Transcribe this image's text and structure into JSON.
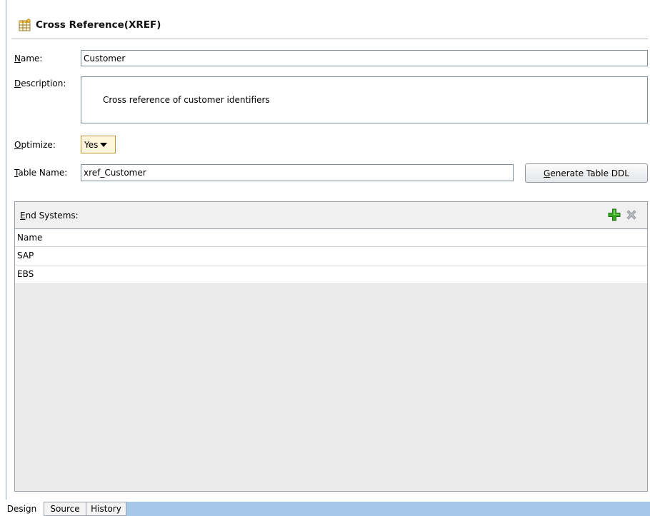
{
  "header": {
    "title": "Cross Reference(XREF)",
    "icon": "xref-table-icon"
  },
  "form": {
    "name_label": {
      "mnemonic": "N",
      "rest": "ame:"
    },
    "name_value": "Customer",
    "description_label": {
      "mnemonic": "D",
      "rest": "escription:"
    },
    "description_value": "Cross reference of customer identifiers",
    "optimize_label": {
      "mnemonic": "O",
      "rest": "ptimize:"
    },
    "optimize_value": "Yes",
    "table_name_label": {
      "mnemonic": "T",
      "rest": "able Name:"
    },
    "table_name_value": "xref_Customer",
    "generate_button": {
      "mnemonic": "G",
      "rest": "enerate Table DDL"
    }
  },
  "end_systems": {
    "label": {
      "mnemonic": "E",
      "rest": "nd Systems:"
    },
    "add_icon": "add-icon",
    "remove_icon": "remove-icon",
    "column_header": "Name",
    "rows": [
      "SAP",
      "EBS"
    ]
  },
  "tabs": [
    "Design",
    "Source",
    "History"
  ],
  "colors": {
    "accent_select": "#c19238",
    "tabbar": "#a6c8e8",
    "add_green": "#2f9e1f"
  }
}
